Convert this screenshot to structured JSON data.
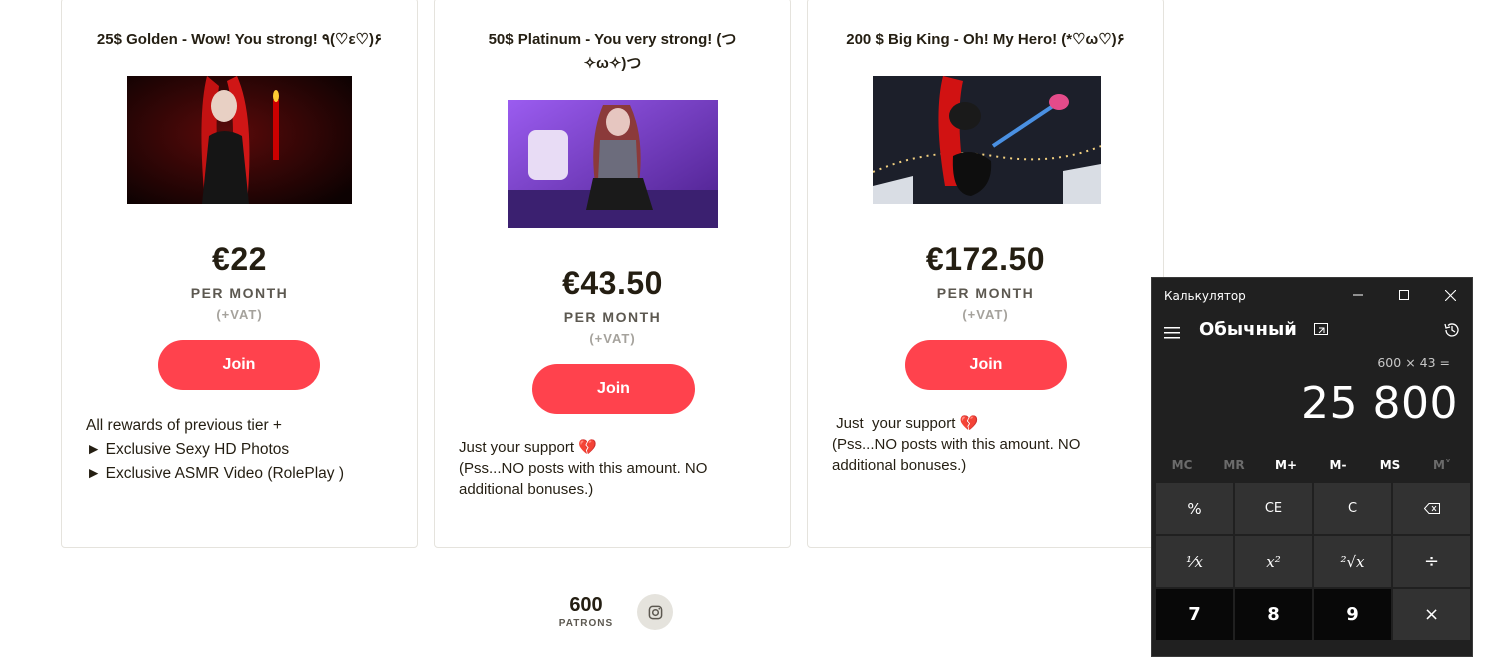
{
  "tiers": [
    {
      "title": "25$ Golden - Wow! You strong! ٩(♡ε♡)۶",
      "price": "€22",
      "per_month": "PER MONTH",
      "vat": "(+VAT)",
      "join": "Join",
      "description": [
        "All rewards of previous tier +",
        "► Exclusive Sexy HD Photos",
        "► Exclusive ASMR Video (RolePlay )"
      ]
    },
    {
      "title": "50$ Platinum - You very strong! (つ ✧ω✧)つ",
      "price": "€43.50",
      "per_month": "PER MONTH",
      "vat": "(+VAT)",
      "join": "Join",
      "description_lead": "Just your support",
      "description": [
        "(Pss...NO posts with this amount. NO",
        "additional bonuses.)"
      ]
    },
    {
      "title": "200 $ Big King - Oh! My Hero! (*♡ω♡)۶",
      "price": "€172.50",
      "per_month": "PER MONTH",
      "vat": "(+VAT)",
      "join": "Join",
      "description_lead": " Just  your support",
      "description": [
        "(Pss...NO posts with this amount. NO",
        "additional bonuses.)"
      ]
    }
  ],
  "stats": {
    "count": "600",
    "label": "PATRONS"
  },
  "social": {
    "icon": "instagram-icon"
  },
  "calculator": {
    "window_title": "Калькулятор",
    "mode": "Обычный",
    "expression": "600 × 43 =",
    "display": "25 800",
    "memory": [
      "MC",
      "MR",
      "M+",
      "M-",
      "MS",
      "M˅"
    ],
    "keys": [
      "%",
      "CE",
      "C",
      "⌫",
      "¹⁄x",
      "x²",
      "²√x",
      "÷",
      "7",
      "8",
      "9",
      "×"
    ]
  },
  "colors": {
    "accent": "#ff424d",
    "text": "#241e12",
    "calc_bg": "#202020"
  }
}
